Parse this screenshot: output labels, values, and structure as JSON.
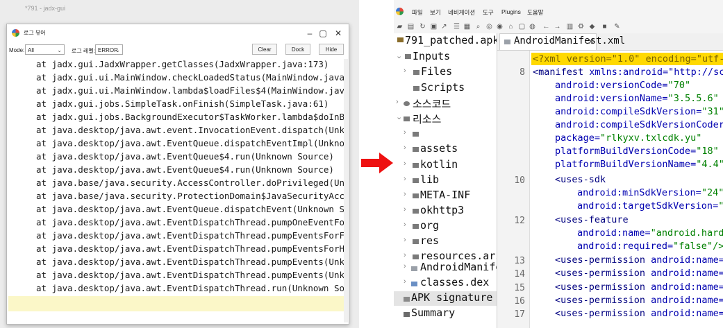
{
  "left": {
    "background_title": "*791 - jadx-gui",
    "window_title": "로그 뷰어",
    "mode_label": "Mode:",
    "mode_value": "All",
    "level_label": "로그 레벨:",
    "level_value": "ERROR",
    "buttons": {
      "clear": "Clear",
      "dock": "Dock",
      "hide": "Hide"
    },
    "log_lines": [
      "at jadx.gui.JadxWrapper.getClasses(JadxWrapper.java:173)",
      "at jadx.gui.ui.MainWindow.checkLoadedStatus(MainWindow.java:589)",
      "at jadx.gui.ui.MainWindow.lambda$loadFiles$4(MainWindow.java:561)",
      "at jadx.gui.jobs.SimpleTask.onFinish(SimpleTask.java:61)",
      "at jadx.gui.jobs.BackgroundExecutor$TaskWorker.lambda$doInBackgrour",
      "at java.desktop/java.awt.event.InvocationEvent.dispatch(Unknown Sou",
      "at java.desktop/java.awt.EventQueue.dispatchEventImpl(Unknown Sourc",
      "at java.desktop/java.awt.EventQueue$4.run(Unknown Source)",
      "at java.desktop/java.awt.EventQueue$4.run(Unknown Source)",
      "at java.base/java.security.AccessController.doPrivileged(Unknown So",
      "at java.base/java.security.ProtectionDomain$JavaSecurityAccessImpl.",
      "at java.desktop/java.awt.EventQueue.dispatchEvent(Unknown Source)",
      "at java.desktop/java.awt.EventDispatchThread.pumpOneEventForFilters",
      "at java.desktop/java.awt.EventDispatchThread.pumpEventsForFilter(Ur",
      "at java.desktop/java.awt.EventDispatchThread.pumpEventsForHierarchy",
      "at java.desktop/java.awt.EventDispatchThread.pumpEvents(Unknown Sou",
      "at java.desktop/java.awt.EventDispatchThread.pumpEvents(Unknown Sou",
      "at java.desktop/java.awt.EventDispatchThread.run(Unknown Source)"
    ]
  },
  "right": {
    "menu": [
      "파일",
      "보기",
      "네비게이션",
      "도구",
      "Plugins",
      "도움말"
    ],
    "tree": {
      "root": "791_patched.apk",
      "inputs": "Inputs",
      "files": "Files",
      "scripts": "Scripts",
      "source_code": "소스코드",
      "resources": "리소스",
      "folders": [
        "assets",
        "kotlin",
        "lib",
        "META-INF",
        "okhttp3",
        "org",
        "res",
        "resources.ars"
      ],
      "manifest": "AndroidManife",
      "classes": "classes.dex",
      "apk_signature": "APK signature",
      "summary": "Summary"
    },
    "tab_label": "AndroidManifest.xml",
    "line_numbers": [
      "8",
      "10",
      "12",
      "13",
      "14",
      "15",
      "16",
      "17"
    ],
    "code": {
      "xml_decl": "<?xml version=\"1.0\" encoding=\"utf-",
      "manifest_tag": "<manifest",
      "manifest_attr": " xmlns:android=\"http://sc",
      "attrs": [
        {
          "name": "android:versionCode=",
          "value": "\"70\""
        },
        {
          "name": "android:versionName=",
          "value": "\"3.5.5.6\""
        },
        {
          "name": "android:compileSdkVersion=",
          "value": "\"31\""
        },
        {
          "name": "android:compileSdkVersionCoder",
          "value": ""
        },
        {
          "name": "package=",
          "value": "\"rlkyxv.txlcdk.yu\""
        },
        {
          "name": "platformBuildVersionCode=",
          "value": "\"18\""
        },
        {
          "name": "platformBuildVersionName=",
          "value": "\"4.4\""
        }
      ],
      "uses_sdk": "<uses-sdk",
      "min_sdk": {
        "name": "android:minSdkVersion=",
        "value": "\"24\""
      },
      "target_sdk": {
        "name": "android:targetSdkVersion=",
        "value": "\""
      },
      "uses_feature": "<uses-feature",
      "feature_name": {
        "name": "android:name=",
        "value": "\"android.hard"
      },
      "feature_required": {
        "name": "android:required=",
        "value": "\"false\"/>"
      },
      "perm_tag": "<uses-permission",
      "perm_attr": " android:name="
    }
  }
}
